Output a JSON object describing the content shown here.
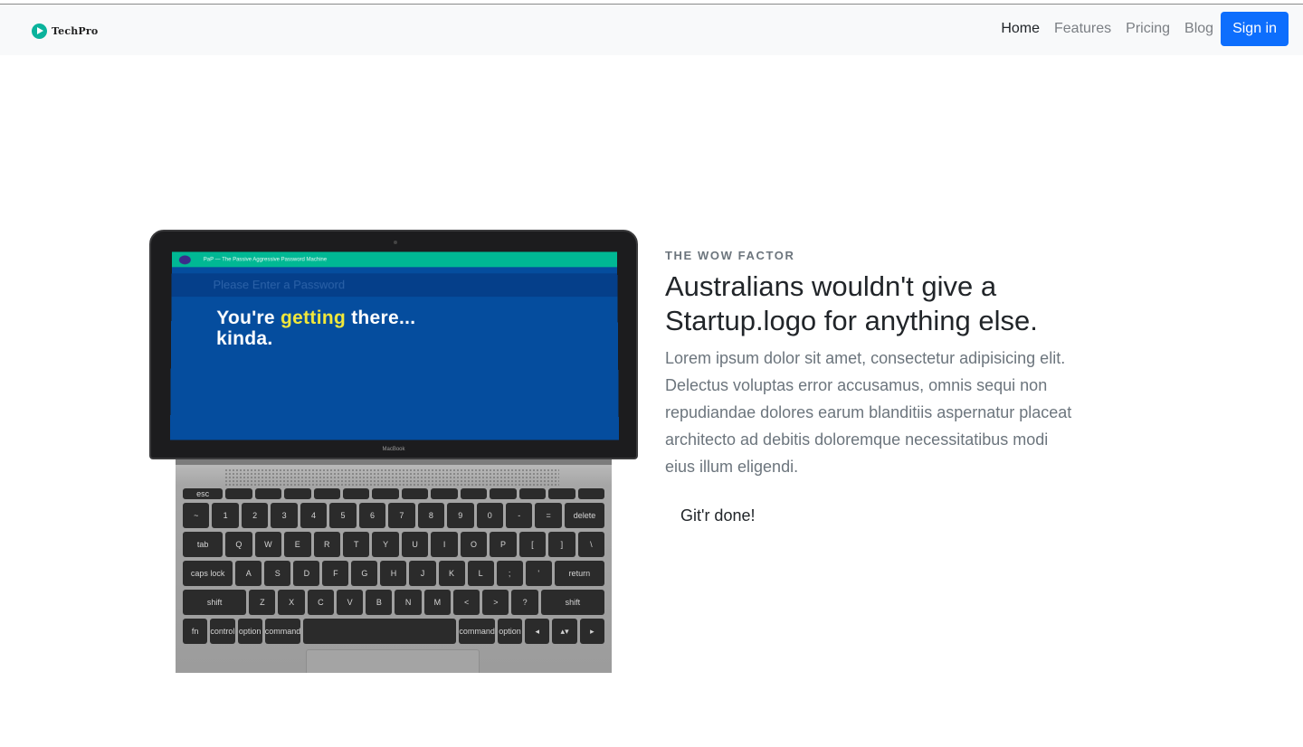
{
  "brand": {
    "name": "TechPro",
    "icon": "play-circle-icon",
    "color": "#0ab39c"
  },
  "nav": {
    "links": [
      {
        "label": "Home",
        "active": true
      },
      {
        "label": "Features",
        "active": false
      },
      {
        "label": "Pricing",
        "active": false
      },
      {
        "label": "Blog",
        "active": false
      }
    ],
    "signin_label": "Sign in",
    "accent": "#0d6efd"
  },
  "hero": {
    "eyebrow": "THE WOW FACTOR",
    "headline": "Australians wouldn't give a Startup.logo for anything else.",
    "body": "Lorem ipsum dolor sit amet, consectetur adipisicing elit. Delectus voluptas error accusamus, omnis sequi non repudiandae dolores earum blanditiis aspernatur placeat architecto ad debitis doloremque necessitatibus modi eius illum eligendi.",
    "cta_label": "Git'r done!"
  },
  "laptop": {
    "app_title": "PaP — The Passive Aggressive Password Machine",
    "placeholder": "Please Enter a Password",
    "message_pre": "You're ",
    "message_highlight": "getting",
    "message_post": " there...",
    "message_line2": "kinda.",
    "bezel_label": "MacBook",
    "keys": {
      "row1": [
        "esc",
        "",
        "",
        "",
        "",
        "",
        "",
        "",
        "",
        "",
        "",
        "",
        "",
        ""
      ],
      "row2": [
        "~",
        "1",
        "2",
        "3",
        "4",
        "5",
        "6",
        "7",
        "8",
        "9",
        "0",
        "-",
        "=",
        "delete"
      ],
      "row3": [
        "tab",
        "Q",
        "W",
        "E",
        "R",
        "T",
        "Y",
        "U",
        "I",
        "O",
        "P",
        "[",
        "]",
        "\\"
      ],
      "row4": [
        "caps lock",
        "A",
        "S",
        "D",
        "F",
        "G",
        "H",
        "J",
        "K",
        "L",
        ";",
        "'",
        "return"
      ],
      "row5": [
        "shift",
        "Z",
        "X",
        "C",
        "V",
        "B",
        "N",
        "M",
        "<",
        ">",
        "?",
        "shift"
      ],
      "row6": [
        "fn",
        "control",
        "option",
        "command",
        "",
        "command",
        "option",
        "◂",
        "▴▾",
        "▸"
      ]
    }
  }
}
